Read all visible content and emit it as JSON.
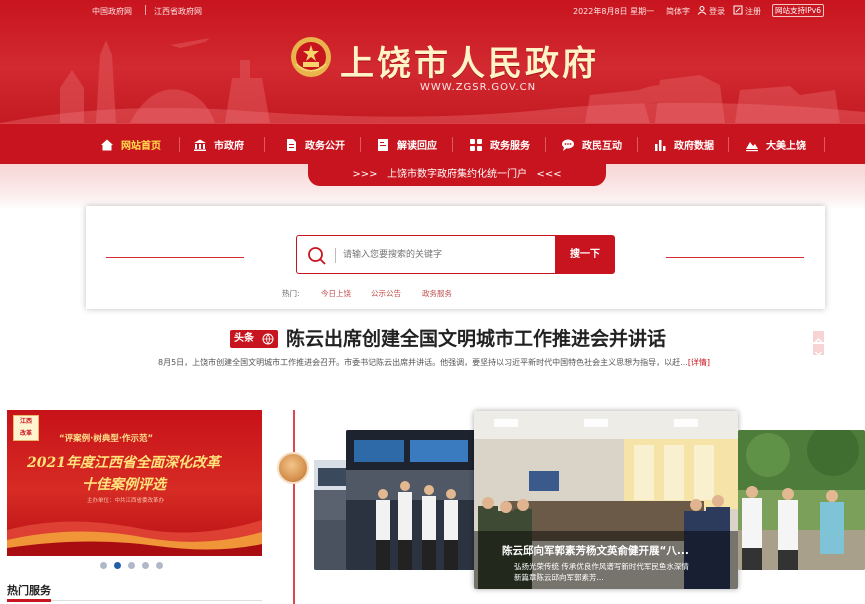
{
  "topbar": {
    "links": [
      "中国政府网",
      "江西省政府网"
    ],
    "date": "2022年8月8日 星期一",
    "lang_label": "简体字",
    "login_label": "登录",
    "register_label": "注册",
    "ipv6_label": "网站支持IPv6"
  },
  "header": {
    "title": "上饶市人民政府",
    "url": "WWW.ZGSR.GOV.CN"
  },
  "nav": {
    "items": [
      {
        "label": "网站首页",
        "icon": "home-icon",
        "active": true
      },
      {
        "label": "市政府",
        "icon": "building-icon"
      },
      {
        "label": "政务公开",
        "icon": "document-icon"
      },
      {
        "label": "解读回应",
        "icon": "book-icon"
      },
      {
        "label": "政务服务",
        "icon": "grid-icon"
      },
      {
        "label": "政民互动",
        "icon": "chat-icon"
      },
      {
        "label": "政府数据",
        "icon": "bar-chart-icon"
      },
      {
        "label": "大美上饶",
        "icon": "landscape-icon"
      }
    ]
  },
  "slogan": "上饶市数字政府集约化统一门户",
  "slogan_arrows_left": ">>>",
  "slogan_arrows_right": "<<<",
  "search": {
    "placeholder": "请输入您要搜索的关键字",
    "button_label": "搜一下",
    "hot_label": "热门:",
    "hot_links": [
      "今日上饶",
      "公示公告",
      "政务服务"
    ]
  },
  "headline": {
    "tag": "头条",
    "title": "陈云出席创建全国文明城市工作推进会并讲话",
    "summary": "8月5日，上饶市创建全国文明城市工作推进会召开。市委书记陈云出席并讲话。他强调，要坚持以习近平新时代中国特色社会主义思想为指导，以赶...",
    "more_label": "[详情]"
  },
  "promo": {
    "badge_line1": "江西",
    "badge_line2": "改革",
    "subtitle": "“评案例·树典型·作示范”",
    "title_line1": "2021年度江西省全面深化改革",
    "title_line2": "十佳案例评选",
    "org": "主办单位：中共江西省委改革办"
  },
  "carousel": {
    "dots": 5,
    "active_dot": 1
  },
  "hot_services_title": "热门服务",
  "featured": {
    "title": "陈云邱向军郭素芳杨文英俞健开展“八...",
    "subtitle_line1": "弘扬光荣传统 传承优良作风谱写新时代军民鱼水深情",
    "subtitle_line2": "新篇章陈云邱向军郭素芳..."
  },
  "colors": {
    "brand_red": "#c8141e",
    "active_nav": "#ffe04a",
    "title_gold": "#fff3c7"
  }
}
